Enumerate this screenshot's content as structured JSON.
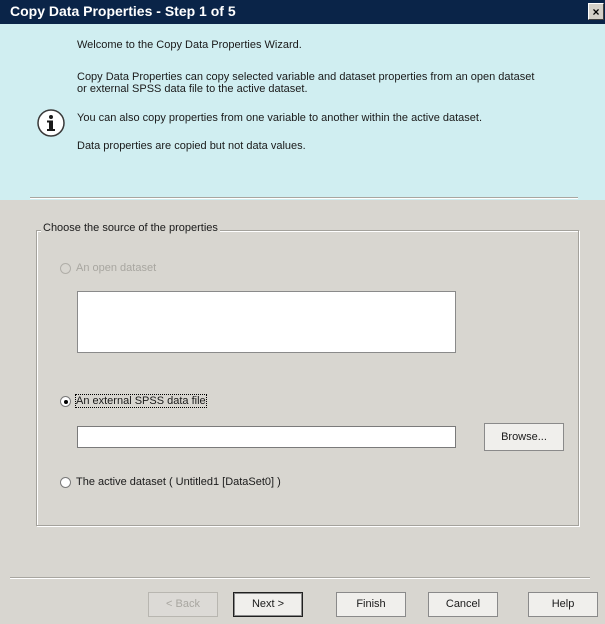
{
  "window": {
    "title": "Copy Data Properties - Step 1 of 5",
    "close_glyph": "×"
  },
  "header": {
    "icon": "info-icon",
    "line1": "Welcome to the Copy Data Properties Wizard.",
    "line2": "Copy Data Properties can copy selected variable and dataset properties from an open dataset",
    "line3": "or external SPSS data file to the active dataset.",
    "line4": "You can also copy properties from one variable to another within the active dataset.",
    "line5": "Data properties are copied but not data values."
  },
  "source_group": {
    "label": "Choose the source of the properties",
    "options": [
      {
        "label": "An open dataset",
        "selected": false,
        "enabled": false
      },
      {
        "label": "An external SPSS data file",
        "selected": true,
        "enabled": true
      },
      {
        "label": "The active dataset ( Untitled1 [DataSet0] )",
        "selected": false,
        "enabled": true
      }
    ],
    "file_path_value": "",
    "browse_label": "Browse..."
  },
  "footer": {
    "back_label": "< Back",
    "next_label": "Next >",
    "finish_label": "Finish",
    "cancel_label": "Cancel",
    "help_label": "Help"
  },
  "colors": {
    "titlebar": "#0a2448",
    "header_band": "#d0eef1",
    "dialog_bg": "#d8d6d0"
  }
}
